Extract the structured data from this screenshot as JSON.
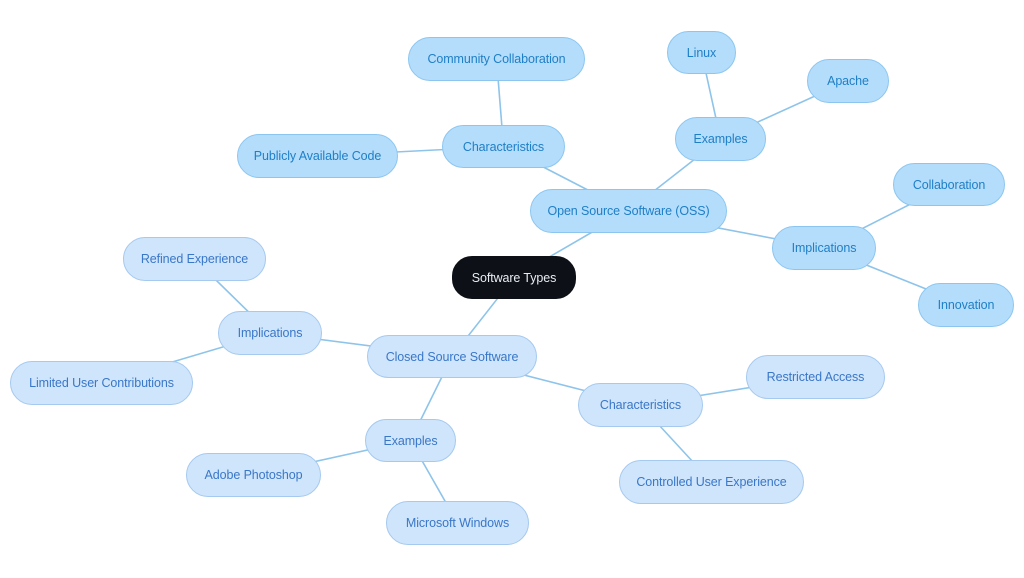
{
  "diagram": {
    "type": "mind-map",
    "colors": {
      "root_fill": "#0d1117",
      "root_text": "#e8edf3",
      "oss_fill": "#b4ddfb",
      "oss_text": "#1f7fc6",
      "closed_fill": "#cfe5fb",
      "closed_text": "#3a77c8",
      "edge": "#8ec4ea"
    },
    "nodes": {
      "root": "Software Types",
      "oss": "Open Source Software (OSS)",
      "oss_characteristics": "Characteristics",
      "oss_community": "Community Collaboration",
      "oss_public_code": "Publicly Available Code",
      "oss_examples": "Examples",
      "oss_linux": "Linux",
      "oss_apache": "Apache",
      "oss_implications": "Implications",
      "oss_collaboration": "Collaboration",
      "oss_innovation": "Innovation",
      "closed": "Closed Source Software",
      "closed_implications": "Implications",
      "closed_refined": "Refined Experience",
      "closed_limited": "Limited User Contributions",
      "closed_examples": "Examples",
      "closed_photoshop": "Adobe Photoshop",
      "closed_windows": "Microsoft Windows",
      "closed_characteristics": "Characteristics",
      "closed_restricted": "Restricted Access",
      "closed_controlled": "Controlled User Experience"
    },
    "edges": [
      [
        "root",
        "oss"
      ],
      [
        "root",
        "closed"
      ],
      [
        "oss",
        "oss_characteristics"
      ],
      [
        "oss_characteristics",
        "oss_community"
      ],
      [
        "oss_characteristics",
        "oss_public_code"
      ],
      [
        "oss",
        "oss_examples"
      ],
      [
        "oss_examples",
        "oss_linux"
      ],
      [
        "oss_examples",
        "oss_apache"
      ],
      [
        "oss",
        "oss_implications"
      ],
      [
        "oss_implications",
        "oss_collaboration"
      ],
      [
        "oss_implications",
        "oss_innovation"
      ],
      [
        "closed",
        "closed_implications"
      ],
      [
        "closed_implications",
        "closed_refined"
      ],
      [
        "closed_implications",
        "closed_limited"
      ],
      [
        "closed",
        "closed_examples"
      ],
      [
        "closed_examples",
        "closed_photoshop"
      ],
      [
        "closed_examples",
        "closed_windows"
      ],
      [
        "closed",
        "closed_characteristics"
      ],
      [
        "closed_characteristics",
        "closed_restricted"
      ],
      [
        "closed_characteristics",
        "closed_controlled"
      ]
    ]
  }
}
